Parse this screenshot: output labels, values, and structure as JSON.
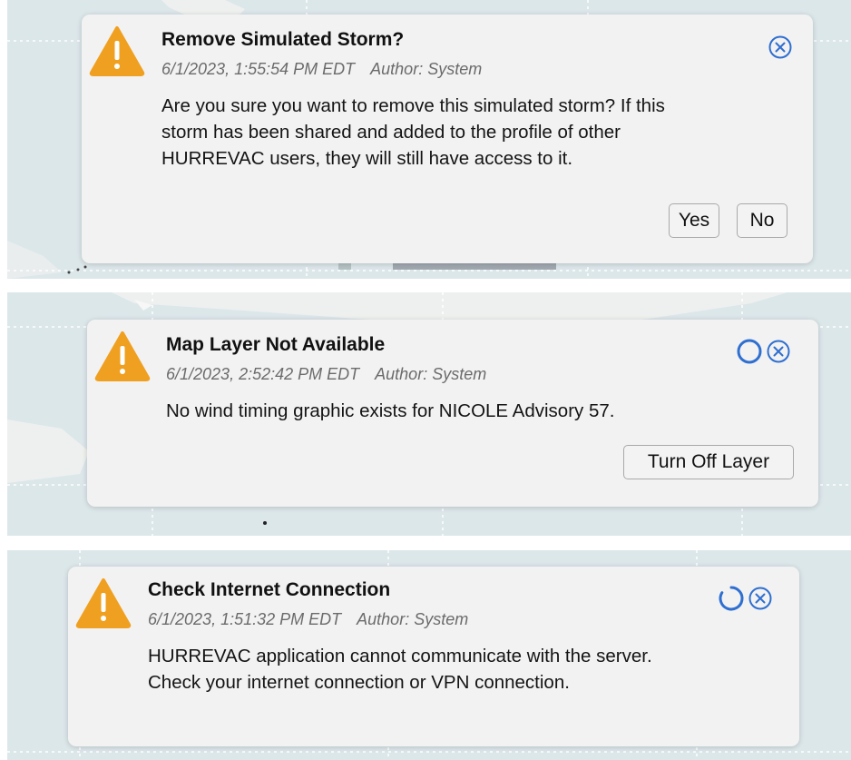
{
  "notifications": [
    {
      "title": "Remove Simulated Storm?",
      "timestamp": "6/1/2023, 1:55:54 PM EDT",
      "author": "Author: System",
      "message_lines": [
        "Are you sure you want to remove this simulated storm? If this",
        "storm has been shared and added to the profile of other",
        "HURREVAC users, they will still have access to it."
      ],
      "buttons": [
        "Yes",
        "No"
      ],
      "icons": [
        "warning-icon",
        "close-icon"
      ]
    },
    {
      "title": "Map Layer Not Available",
      "timestamp": "6/1/2023, 2:52:42 PM EDT",
      "author": "Author: System",
      "message_lines": [
        "No wind timing graphic exists for NICOLE Advisory 57."
      ],
      "buttons": [
        "Turn Off Layer"
      ],
      "icons": [
        "warning-icon",
        "timer-ring-icon",
        "close-icon"
      ]
    },
    {
      "title": "Check Internet Connection",
      "timestamp": "6/1/2023, 1:51:32 PM EDT",
      "author": "Author: System",
      "message_lines": [
        "HURREVAC application cannot communicate with the server.",
        "Check your internet connection or VPN connection."
      ],
      "buttons": [],
      "icons": [
        "warning-icon",
        "timer-ring-icon",
        "close-icon"
      ]
    }
  ],
  "colors": {
    "warning": "#f0a020",
    "accent_blue": "#2f6fd0",
    "card_background": "#f2f2f2",
    "map_water": "#dce7ea",
    "map_land": "#eef0ef"
  }
}
